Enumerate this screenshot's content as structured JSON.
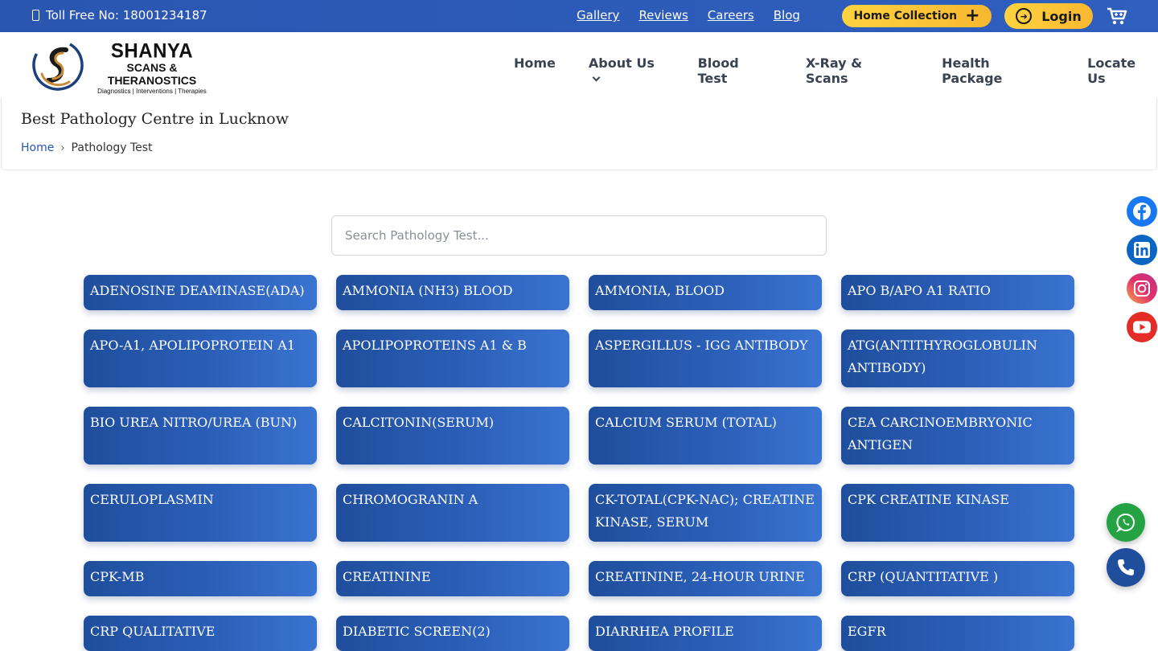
{
  "topbar": {
    "toll_free": "Toll Free No: 18001234187",
    "links": [
      "Gallery",
      "Reviews",
      "Careers",
      "Blog"
    ],
    "home_collection": "Home Collection",
    "login": "Login"
  },
  "brand": {
    "name": "SHANYA",
    "subtitle": "SCANS & THERANOSTICS",
    "tagline": "Diagnostics | Interventions | Therapies"
  },
  "nav": {
    "items": [
      "Home",
      "About Us",
      "Blood Test",
      "X-Ray & Scans",
      "Health Package",
      "Locate Us"
    ]
  },
  "page": {
    "title": "Best Pathology Centre in Lucknow",
    "breadcrumb": [
      "Home",
      "Pathology Test"
    ]
  },
  "search": {
    "placeholder": "Search Pathology Test...",
    "value": ""
  },
  "tests": [
    "ADENOSINE DEAMINASE(ADA)",
    "AMMONIA (NH3) BLOOD",
    "AMMONIA, BLOOD",
    "APO B/APO A1 RATIO",
    "APO-A1, APOLIPOPROTEIN A1",
    "APOLIPOPROTEINS A1 & B",
    "ASPERGILLUS - IGG ANTIBODY",
    "ATG(ANTITHYROGLOBULIN ANTIBODY)",
    "BIO UREA NITRO/UREA (BUN)",
    "CALCITONIN(SERUM)",
    "CALCIUM SERUM (TOTAL)",
    "CEA CARCINOEMBRYONIC ANTIGEN",
    "CERULOPLASMIN",
    "CHROMOGRANIN A",
    "CK-TOTAL(CPK-NAC); CREATINE KINASE, SERUM",
    "CPK CREATINE KINASE",
    "CPK-MB",
    "CREATININE",
    "CREATININE, 24-HOUR URINE",
    "CRP (QUANTITATIVE )",
    "CRP QUALITATIVE",
    "DIABETIC SCREEN(2)",
    "DIARRHEA PROFILE",
    "EGFR"
  ],
  "social": [
    "facebook-icon",
    "linkedin-icon",
    "instagram-icon",
    "youtube-icon"
  ],
  "colors": {
    "primary": "#2a56b0",
    "accent": "#f7b731",
    "facebook": "#1877f2",
    "linkedin": "#0a66c2",
    "instagram": "#e1306c",
    "youtube": "#e52d27",
    "whatsapp": "#25a244",
    "call": "#1f4e9c"
  }
}
